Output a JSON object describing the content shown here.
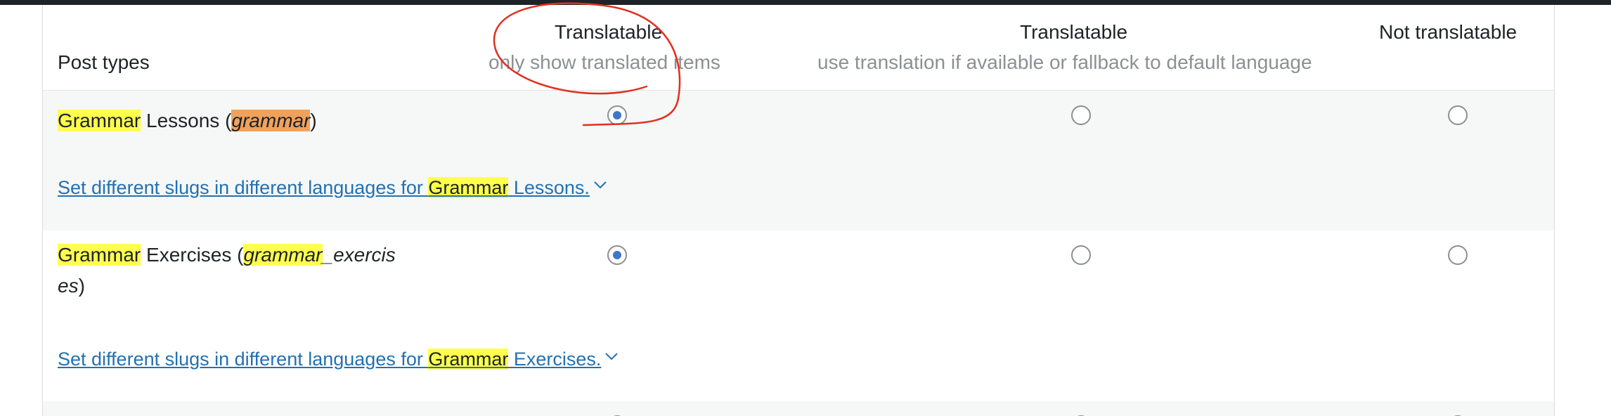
{
  "columns": {
    "post_types": "Post types",
    "col1_title": "Translatable",
    "col1_sub": "only show translated items",
    "col2_title": "Translatable",
    "col2_sub": "use translation if available or fallback to default language",
    "col3_title": "Not translatable"
  },
  "rows": [
    {
      "name_hl": "Grammar",
      "name_rest": " Lessons (",
      "slug_hl": "grammar",
      "slug_rest": "",
      "close": ")",
      "selected": "translatable_only",
      "slug_link_prefix": "Set different slugs in different languages for ",
      "slug_link_hl": "Grammar",
      "slug_link_suffix": " Lessons."
    },
    {
      "name_hl": "Grammar",
      "name_rest": " Exercises (",
      "slug_hl": "grammar",
      "slug_rest": "_exercis",
      "slug_wrap": "es",
      "close": ")",
      "selected": "translatable_only",
      "slug_link_prefix": "Set different slugs in different languages for ",
      "slug_link_hl": "Grammar",
      "slug_link_suffix": " Exercises."
    }
  ],
  "icons": {
    "expand": "chevron-down-icon"
  },
  "colors": {
    "highlight": "#ffff4d",
    "highlight_orange": "#f0a25c",
    "link": "#2271b1",
    "radio_checked": "#3e77c8",
    "annotation": "#e0301e"
  }
}
